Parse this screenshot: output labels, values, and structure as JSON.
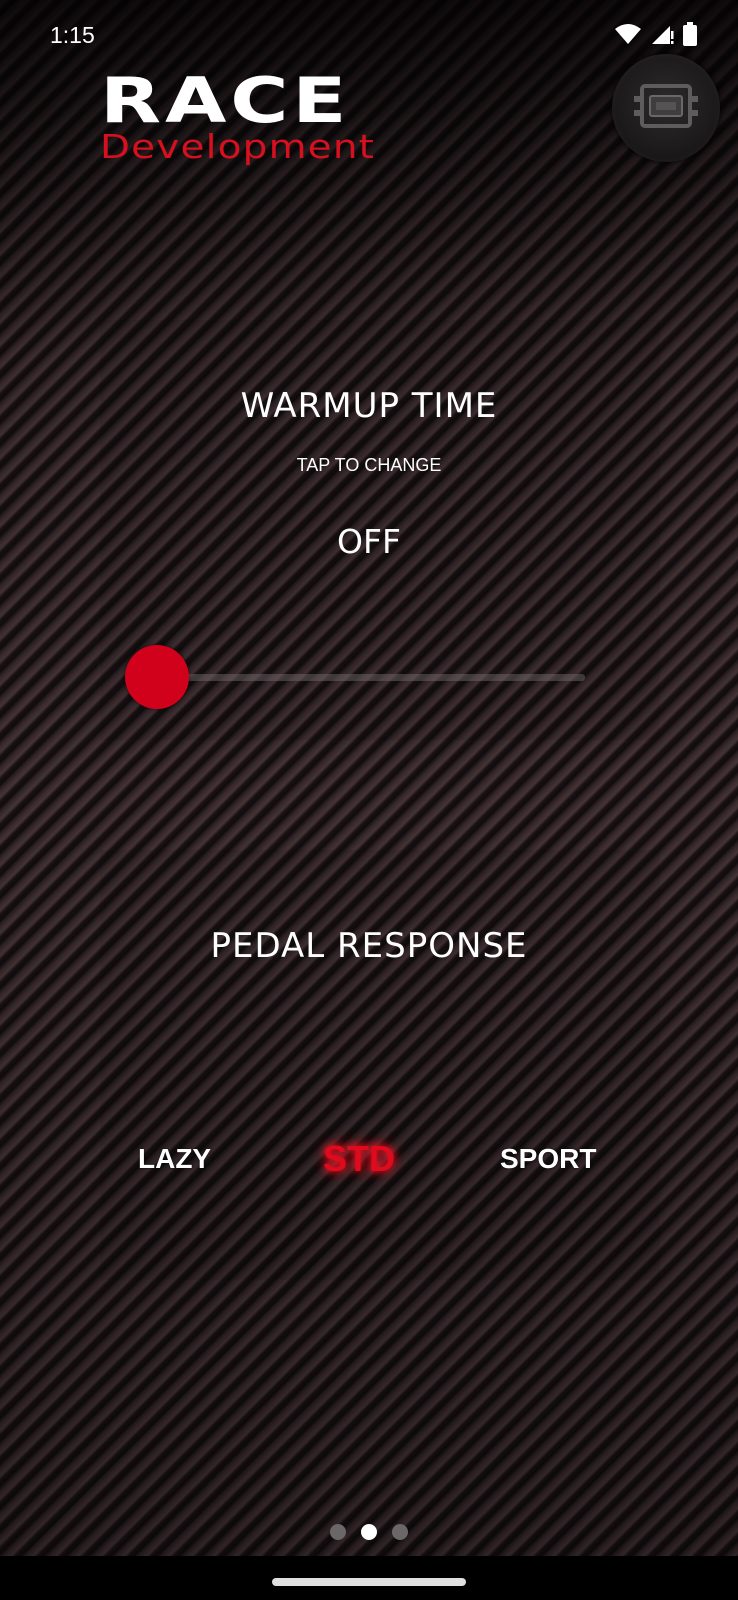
{
  "status_bar": {
    "time": "1:15",
    "icons": [
      "wifi-icon",
      "signal-icon",
      "battery-icon"
    ]
  },
  "logo": {
    "line1": "RACE",
    "line2": "Development",
    "accent_color": "#d6101e"
  },
  "device_button": {
    "icon": "ecu-chip-icon"
  },
  "warmup": {
    "title": "WARMUP TIME",
    "hint": "TAP TO CHANGE",
    "value": "OFF",
    "slider_level": 0,
    "thumb_color": "#d1001b"
  },
  "pedal_response": {
    "title": "PEDAL RESPONSE",
    "modes": [
      {
        "label": "LAZY",
        "selected": false
      },
      {
        "label": "STD",
        "selected": true
      },
      {
        "label": "SPORT",
        "selected": false
      }
    ],
    "selected_color": "#e10a1c"
  },
  "pager": {
    "count": 3,
    "active_index": 1
  }
}
